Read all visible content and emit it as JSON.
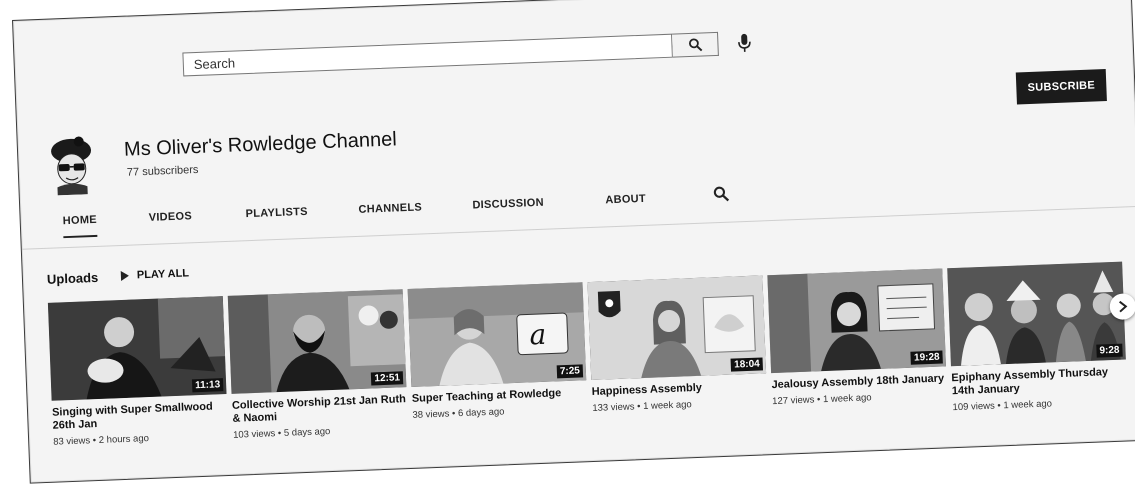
{
  "search": {
    "placeholder": "Search"
  },
  "subscribe_label": "SUBSCRIBE",
  "channel": {
    "name": "Ms Oliver's Rowledge Channel",
    "subscribers": "77 subscribers"
  },
  "tabs": [
    {
      "label": "HOME",
      "active": true
    },
    {
      "label": "VIDEOS"
    },
    {
      "label": "PLAYLISTS"
    },
    {
      "label": "CHANNELS"
    },
    {
      "label": "DISCUSSION"
    },
    {
      "label": "ABOUT"
    }
  ],
  "uploads": {
    "title": "Uploads",
    "play_all": "PLAY ALL"
  },
  "videos": [
    {
      "title": "Singing with Super Smallwood 26th Jan",
      "meta": "83 views • 2 hours ago",
      "duration": "11:13"
    },
    {
      "title": "Collective Worship 21st Jan Ruth & Naomi",
      "meta": "103 views • 5 days ago",
      "duration": "12:51"
    },
    {
      "title": "Super Teaching at Rowledge",
      "meta": "38 views • 6 days ago",
      "duration": "7:25"
    },
    {
      "title": "Happiness Assembly",
      "meta": "133 views • 1 week ago",
      "duration": "18:04"
    },
    {
      "title": "Jealousy Assembly 18th January",
      "meta": "127 views • 1 week ago",
      "duration": "19:28"
    },
    {
      "title": "Epiphany Assembly Thursday 14th January",
      "meta": "109 views • 1 week ago",
      "duration": "9:28"
    }
  ],
  "icons": {
    "search": "search-icon",
    "mic": "mic-icon",
    "next": "chevron-right-icon",
    "play": "play-icon"
  }
}
